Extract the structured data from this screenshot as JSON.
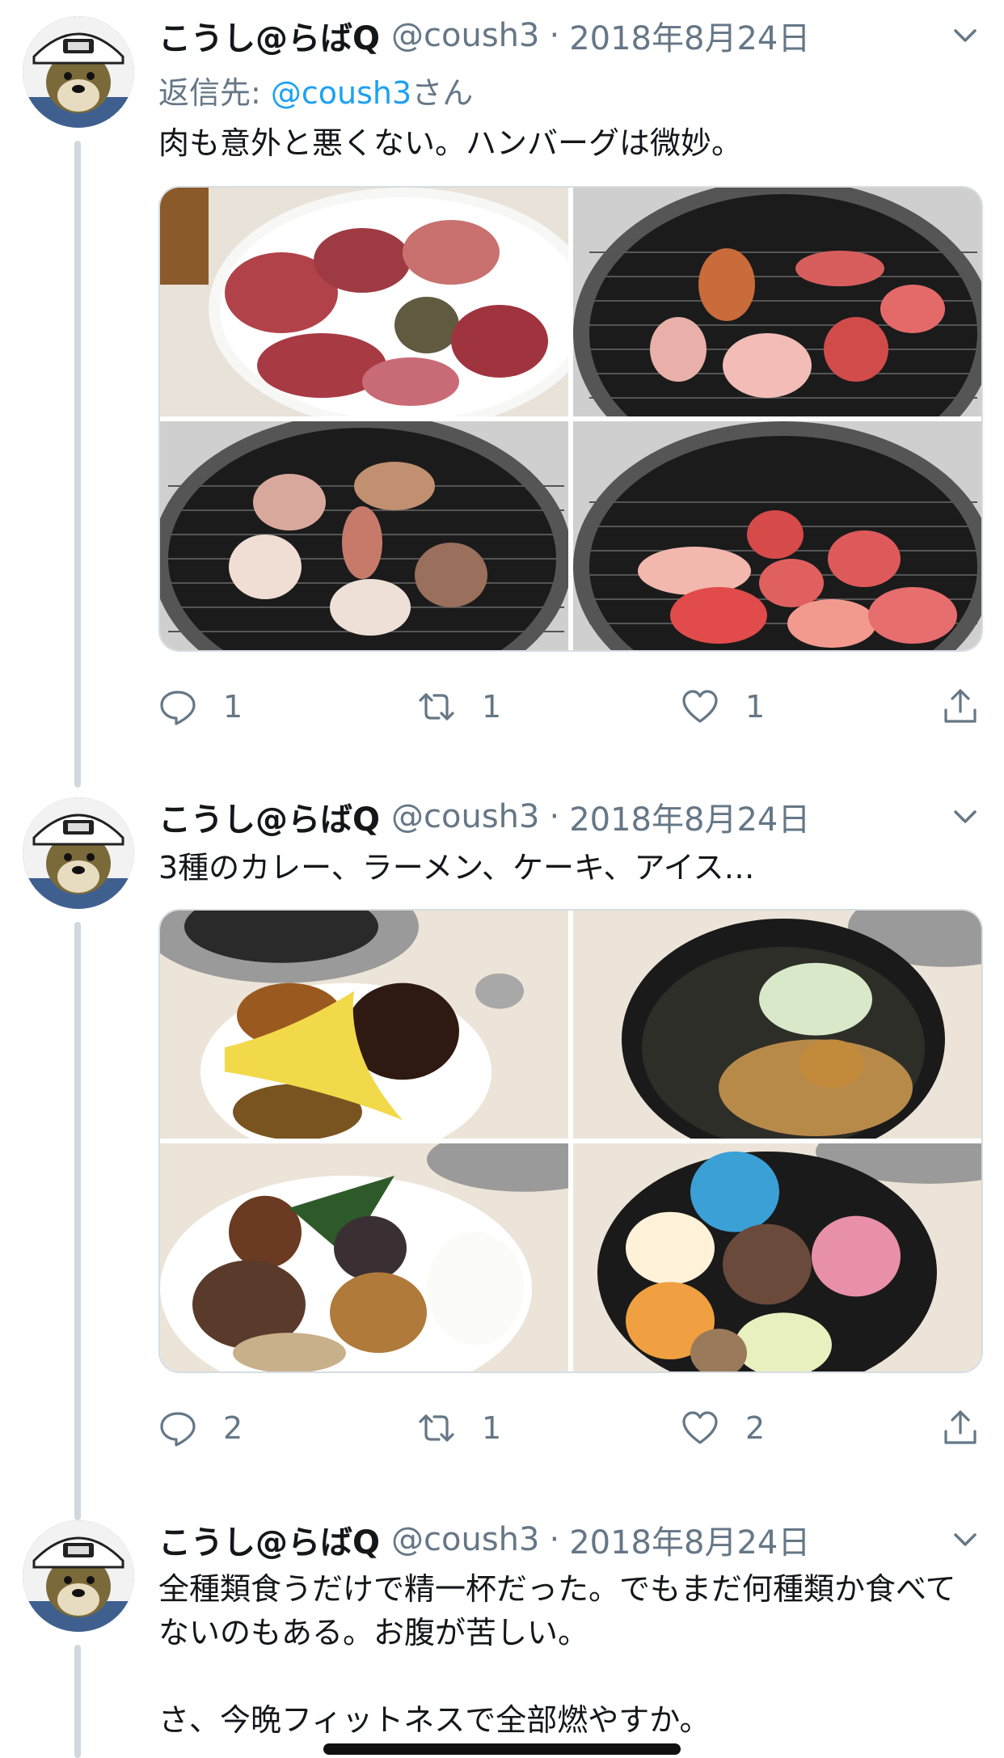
{
  "tweets": [
    {
      "author_name": "こうし@らばQ",
      "handle": "@coush3",
      "separator": "·",
      "date": "2018年8月24日",
      "reply_to_prefix": "返信先: ",
      "reply_to_mention": "@coush3",
      "reply_to_suffix": "さん",
      "text": "肉も意外と悪くない。ハンバーグは微妙。",
      "replies": "1",
      "retweets": "1",
      "likes": "1"
    },
    {
      "author_name": "こうし@らばQ",
      "handle": "@coush3",
      "separator": "·",
      "date": "2018年8月24日",
      "text": "3種のカレー、ラーメン、ケーキ、アイス…",
      "replies": "2",
      "retweets": "1",
      "likes": "2"
    },
    {
      "author_name": "こうし@らばQ",
      "handle": "@coush3",
      "separator": "·",
      "date": "2018年8月24日",
      "text": "全種類食うだけで精一杯だった。でもまだ何種類か食べてないのもある。お腹が苦しい。\n\nさ、今晩フィットネスで全部燃やすか。"
    }
  ],
  "icons": {
    "reply": "reply-icon",
    "retweet": "retweet-icon",
    "like": "heart-icon",
    "share": "share-icon",
    "menu": "chevron-down-icon",
    "avatar": "dog-avatar-icon"
  },
  "colors": {
    "link": "#1da1f2",
    "secondary_text": "#657786",
    "thread_line": "#cfd9de"
  }
}
